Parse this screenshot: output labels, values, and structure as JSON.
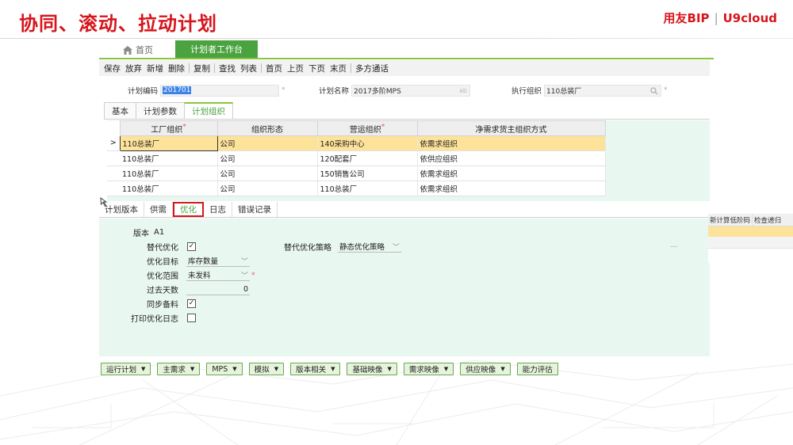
{
  "slide": {
    "title": "协同、滚动、拉动计划",
    "brand_name": "用友BIP",
    "brand_sep": "|",
    "brand_product": "U9cloud"
  },
  "colors": {
    "brand_red": "#d7151c",
    "tab_green": "#4aa33f",
    "panel_mint": "#e9f7f1",
    "row_highlight": "#fde39a"
  },
  "tabs": {
    "home_icon": "home-icon",
    "home_label": "首页",
    "active_label": "计划者工作台"
  },
  "toolbar": {
    "groups": [
      [
        "保存",
        "放弃",
        "新增",
        "删除"
      ],
      [
        "复制"
      ],
      [
        "查找",
        "列表"
      ],
      [
        "首页",
        "上页",
        "下页",
        "末页"
      ],
      [
        "多方通话"
      ]
    ]
  },
  "form": {
    "plan_code_label": "计划编码",
    "plan_code_value": "201701",
    "plan_code_marker": "*",
    "plan_name_label": "计划名称",
    "plan_name_value": "2017多阶MPS",
    "plan_name_icon": "ab",
    "exec_org_label": "执行组织",
    "exec_org_value": "110总装厂",
    "exec_org_marker": "*"
  },
  "subtabs": [
    "基本",
    "计划参数",
    "计划组织"
  ],
  "grid": {
    "columns": [
      "工厂组织",
      "组织形态",
      "营运组织",
      "净需求货主组织方式"
    ],
    "required_columns": [
      0,
      2
    ],
    "row_marker": ">",
    "rows": [
      [
        "110总装厂",
        "公司",
        "140采购中心",
        "依需求组织"
      ],
      [
        "110总装厂",
        "公司",
        "120配套厂",
        "依供应组织"
      ],
      [
        "110总装厂",
        "公司",
        "150销售公司",
        "依需求组织"
      ],
      [
        "110总装厂",
        "公司",
        "110总装厂",
        "依需求组织"
      ]
    ]
  },
  "lower_tabs": [
    "计划版本",
    "供需",
    "优化",
    "日志",
    "错误记录"
  ],
  "right_partial": {
    "col1": "新计算低阶码",
    "col2": "检查递归"
  },
  "optimize": {
    "version_label": "版本",
    "version_value": "A1",
    "alt_opt_label": "替代优化",
    "alt_strategy_label": "替代优化策略",
    "alt_strategy_value": "静态优化策略",
    "target_label": "优化目标",
    "target_value": "库存数量",
    "scope_label": "优化范围",
    "scope_value": "未发料",
    "scope_marker": "*",
    "past_days_label": "过去天数",
    "past_days_value": "0",
    "sync_label": "同步备料",
    "print_log_label": "打印优化日志",
    "dash": "—"
  },
  "bottom_buttons": [
    {
      "label": "运行计划",
      "dropdown": true
    },
    {
      "label": "主需求",
      "dropdown": true
    },
    {
      "label": "MPS",
      "dropdown": true
    },
    {
      "label": "模拟",
      "dropdown": true
    },
    {
      "label": "版本相关",
      "dropdown": true
    },
    {
      "label": "基础映像",
      "dropdown": true
    },
    {
      "label": "需求映像",
      "dropdown": true
    },
    {
      "label": "供应映像",
      "dropdown": true
    },
    {
      "label": "能力评估",
      "dropdown": false
    }
  ]
}
